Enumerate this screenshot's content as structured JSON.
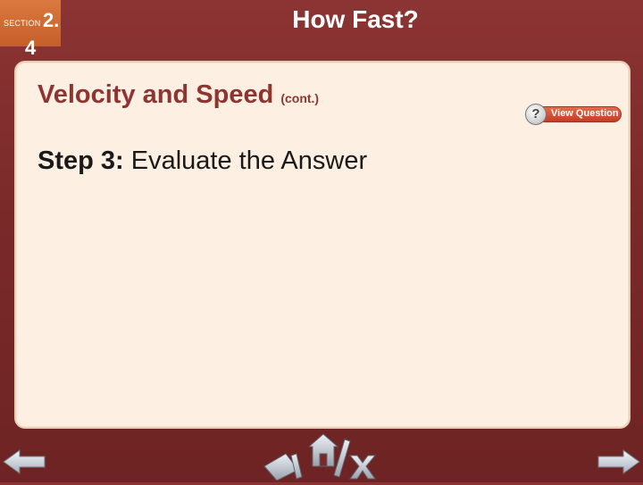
{
  "section": {
    "label": "SECTION",
    "number": "2.",
    "sub": "4"
  },
  "slide": {
    "title": "How Fast?"
  },
  "content": {
    "heading": "Velocity and Speed",
    "heading_suffix": "(cont.)",
    "step_label": "Step 3:",
    "step_text": " Evaluate the Answer"
  },
  "view_question": {
    "label": "View Question",
    "icon": "question-mark-icon",
    "glyph": "?"
  },
  "navigation": {
    "back_icon": "arrow-left-icon",
    "home_icon": "home-icon",
    "close_icon": "close-icon",
    "next_icon": "arrow-right-icon"
  },
  "colors": {
    "background": "#7a2929",
    "section_tab": "#d0692f",
    "panel": "#fdf0e2",
    "heading": "#8e3531",
    "view_question": "#d4502f",
    "nav_arrow": "#c9cdd6"
  }
}
